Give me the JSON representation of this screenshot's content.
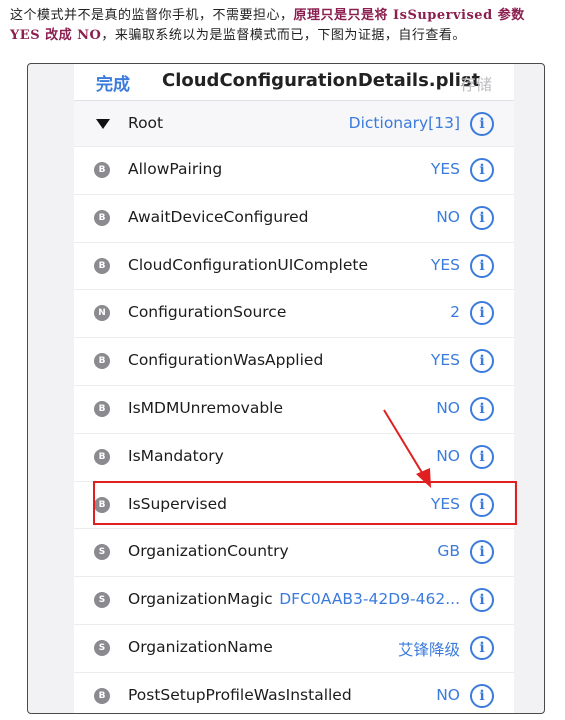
{
  "caption": {
    "part1": "这个模式并不是真的监督你手机，不需要担心，",
    "part2": "原理只是只是将 IsSupervised 参数 YES 改成 NO",
    "part3": "，来骗取系统以为是监督模式而已，下图为证据，自行查看。"
  },
  "nav": {
    "done": "完成",
    "title": "CloudConfigurationDetails.plist",
    "save": "存储"
  },
  "root": {
    "key": "Root",
    "value": "Dictionary[13]"
  },
  "rows": [
    {
      "type": "B",
      "key": "AllowPairing",
      "value": "YES"
    },
    {
      "type": "B",
      "key": "AwaitDeviceConfigured",
      "value": "NO"
    },
    {
      "type": "B",
      "key": "CloudConfigurationUIComplete",
      "value": "YES"
    },
    {
      "type": "N",
      "key": "ConfigurationSource",
      "value": "2"
    },
    {
      "type": "B",
      "key": "ConfigurationWasApplied",
      "value": "YES"
    },
    {
      "type": "B",
      "key": "IsMDMUnremovable",
      "value": "NO"
    },
    {
      "type": "B",
      "key": "IsMandatory",
      "value": "NO"
    },
    {
      "type": "B",
      "key": "IsSupervised",
      "value": "YES"
    },
    {
      "type": "S",
      "key": "OrganizationCountry",
      "value": "GB"
    },
    {
      "type": "S",
      "key": "OrganizationMagic",
      "value": "DFC0AAB3-42D9-462..."
    },
    {
      "type": "S",
      "key": "OrganizationName",
      "value": "艾锋降级"
    },
    {
      "type": "B",
      "key": "PostSetupProfileWasInstalled",
      "value": "NO"
    }
  ],
  "icons": {
    "info": "info-circle-icon",
    "disclosure": "disclosure-triangle-icon"
  },
  "colors": {
    "accent": "#3a7bdc",
    "annotation": "#e02020",
    "caption_highlight": "#8b1f4f"
  }
}
